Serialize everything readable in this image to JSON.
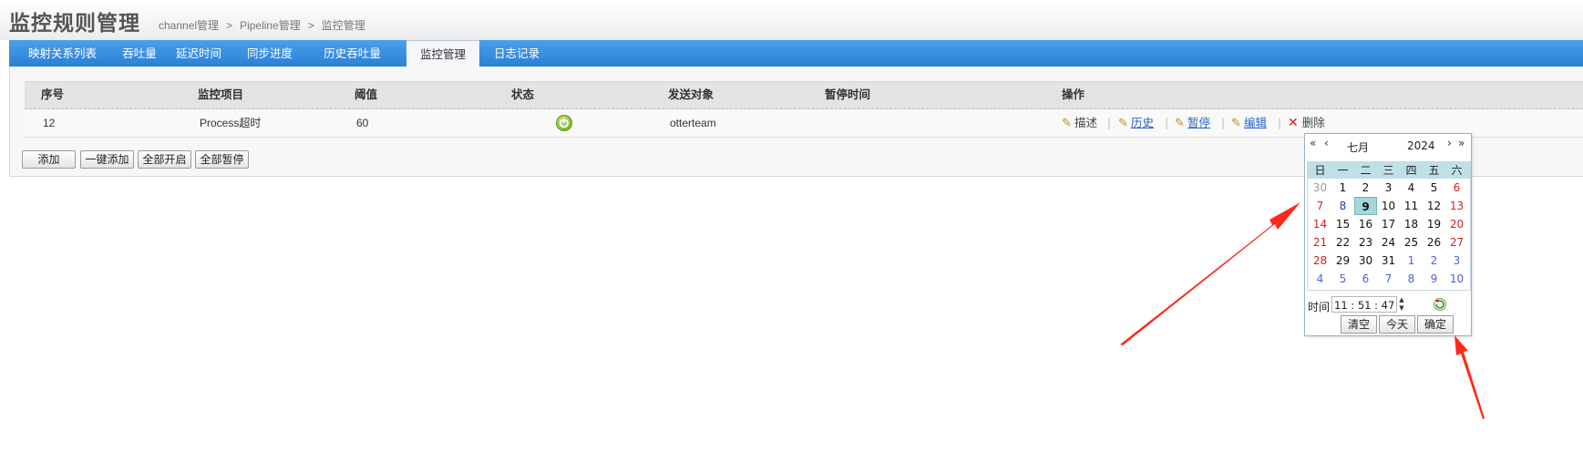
{
  "header": {
    "title": "监控规则管理",
    "breadcrumb": [
      "channel管理",
      "Pipeline管理",
      "监控管理"
    ],
    "breadcrumb_separator": ">"
  },
  "nav": {
    "tabs": [
      "映射关系列表",
      "吞吐量",
      "延迟时间",
      "同步进度",
      "历史吞吐量",
      "监控管理",
      "日志记录"
    ],
    "active": "监控管理"
  },
  "table": {
    "headers": [
      "序号",
      "监控项目",
      "阈值",
      "状态",
      "发送对象",
      "暂停时间",
      "操作"
    ],
    "rows": [
      {
        "id": "12",
        "item": "Process超时",
        "threshold": "60",
        "status": "running",
        "receiver": "otterteam",
        "pause_time": ""
      }
    ],
    "actions": [
      "描述",
      "历史",
      "暂停",
      "编辑",
      "删除"
    ]
  },
  "buttons": {
    "add": "添加",
    "batch_add": "一键添加",
    "enable_all": "全部开启",
    "pause_all": "全部暂停"
  },
  "calendar": {
    "month": "七月",
    "year": "2024",
    "weekdays": [
      "日",
      "一",
      "二",
      "三",
      "四",
      "五",
      "六"
    ],
    "weeks": [
      [
        "30",
        "1",
        "2",
        "3",
        "4",
        "5",
        "6"
      ],
      [
        "7",
        "8",
        "9",
        "10",
        "11",
        "12",
        "13"
      ],
      [
        "14",
        "15",
        "16",
        "17",
        "18",
        "19",
        "20"
      ],
      [
        "21",
        "22",
        "23",
        "24",
        "25",
        "26",
        "27"
      ],
      [
        "28",
        "29",
        "30",
        "31",
        "1",
        "2",
        "3"
      ],
      [
        "4",
        "5",
        "6",
        "7",
        "8",
        "9",
        "10"
      ]
    ],
    "selected_day": "9",
    "time_label": "时间",
    "time_value": "11 : 51 : 47",
    "buttons": [
      "清空",
      "今天",
      "确定"
    ]
  },
  "colors": {
    "nav_bar": "#2b7fd6",
    "weekend_red": "#d81e1e",
    "annotation_arrow": "#ff2a1a",
    "selected_day_bg": "#a5d6da"
  }
}
